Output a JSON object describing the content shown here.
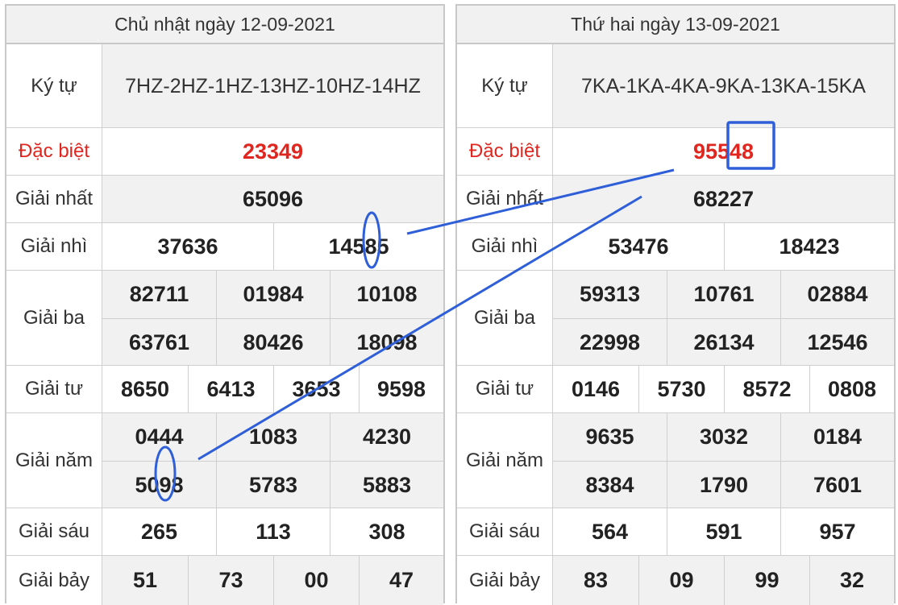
{
  "left": {
    "date": "Chủ nhật ngày 12-09-2021",
    "labels": {
      "kytu": "Ký tự",
      "db": "Đặc biệt",
      "g1": "Giải nhất",
      "g2": "Giải nhì",
      "g3": "Giải ba",
      "g4": "Giải tư",
      "g5": "Giải năm",
      "g6": "Giải sáu",
      "g7": "Giải bảy"
    },
    "kytu": "7HZ-2HZ-1HZ-13HZ-10HZ-14HZ",
    "db": "23349",
    "g1": "65096",
    "g2": [
      "37636",
      "14585"
    ],
    "g3": [
      "82711",
      "01984",
      "10108",
      "63761",
      "80426",
      "18098"
    ],
    "g4": [
      "8650",
      "6413",
      "3653",
      "9598"
    ],
    "g5": [
      "0444",
      "1083",
      "4230",
      "5098",
      "5783",
      "5883"
    ],
    "g6": [
      "265",
      "113",
      "308"
    ],
    "g7": [
      "51",
      "73",
      "00",
      "47"
    ]
  },
  "right": {
    "date": "Thứ hai ngày 13-09-2021",
    "labels": {
      "kytu": "Ký tự",
      "db": "Đặc biệt",
      "g1": "Giải nhất",
      "g2": "Giải nhì",
      "g3": "Giải ba",
      "g4": "Giải tư",
      "g5": "Giải năm",
      "g6": "Giải sáu",
      "g7": "Giải bảy"
    },
    "kytu": "7KA-1KA-4KA-9KA-13KA-15KA",
    "db": "95548",
    "g1": "68227",
    "g2": [
      "53476",
      "18423"
    ],
    "g3": [
      "59313",
      "10761",
      "02884",
      "22998",
      "26134",
      "12546"
    ],
    "g4": [
      "0146",
      "5730",
      "8572",
      "0808"
    ],
    "g5": [
      "9635",
      "3032",
      "0184",
      "8384",
      "1790",
      "7601"
    ],
    "g6": [
      "564",
      "591",
      "957"
    ],
    "g7": [
      "83",
      "09",
      "99",
      "32"
    ]
  },
  "colors": {
    "special": "#e0261e",
    "annotation": "#2f5fd8",
    "header_bg": "#f1f1f1"
  }
}
